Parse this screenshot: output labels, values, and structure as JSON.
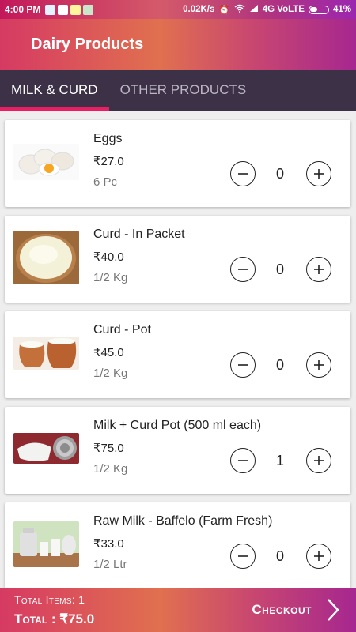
{
  "status_bar": {
    "time": "4:00 PM",
    "network_speed": "0.02K/s",
    "network": "4G VoLTE",
    "battery": "41%"
  },
  "app_bar": {
    "title": "Dairy Products"
  },
  "tabs": [
    {
      "label": "MILK & CURD",
      "active": true
    },
    {
      "label": "OTHER PRODUCTS",
      "active": false
    }
  ],
  "products": [
    {
      "name": " Eggs",
      "price": "₹27.0",
      "unit": "6 Pc",
      "count": "0",
      "image": "eggs-image"
    },
    {
      "name": "Curd - In Packet",
      "price": "₹40.0",
      "unit": "1/2 Kg",
      "count": "0",
      "image": "curd-packet-image"
    },
    {
      "name": "Curd - Pot",
      "price": "₹45.0",
      "unit": "1/2 Kg",
      "count": "0",
      "image": "curd-pot-image"
    },
    {
      "name": "Milk + Curd Pot (500 ml each)",
      "price": "₹75.0",
      "unit": "1/2 Kg",
      "count": "1",
      "image": "milk-curd-pot-image"
    },
    {
      "name": "Raw Milk - Baffelo (Farm Fresh)",
      "price": "₹33.0",
      "unit": "1/2 Ltr",
      "count": "0",
      "image": "raw-milk-image"
    }
  ],
  "footer": {
    "total_items_label": "Total Items: ",
    "total_items_value": "1",
    "total_label": "Total : ",
    "total_value": "₹75.0",
    "checkout_label": "Checkout"
  },
  "colors": {
    "accent": "#e91e63",
    "tab_bar": "#3c3147",
    "gradient_start": "#d63a63",
    "gradient_end": "#a6278f"
  }
}
